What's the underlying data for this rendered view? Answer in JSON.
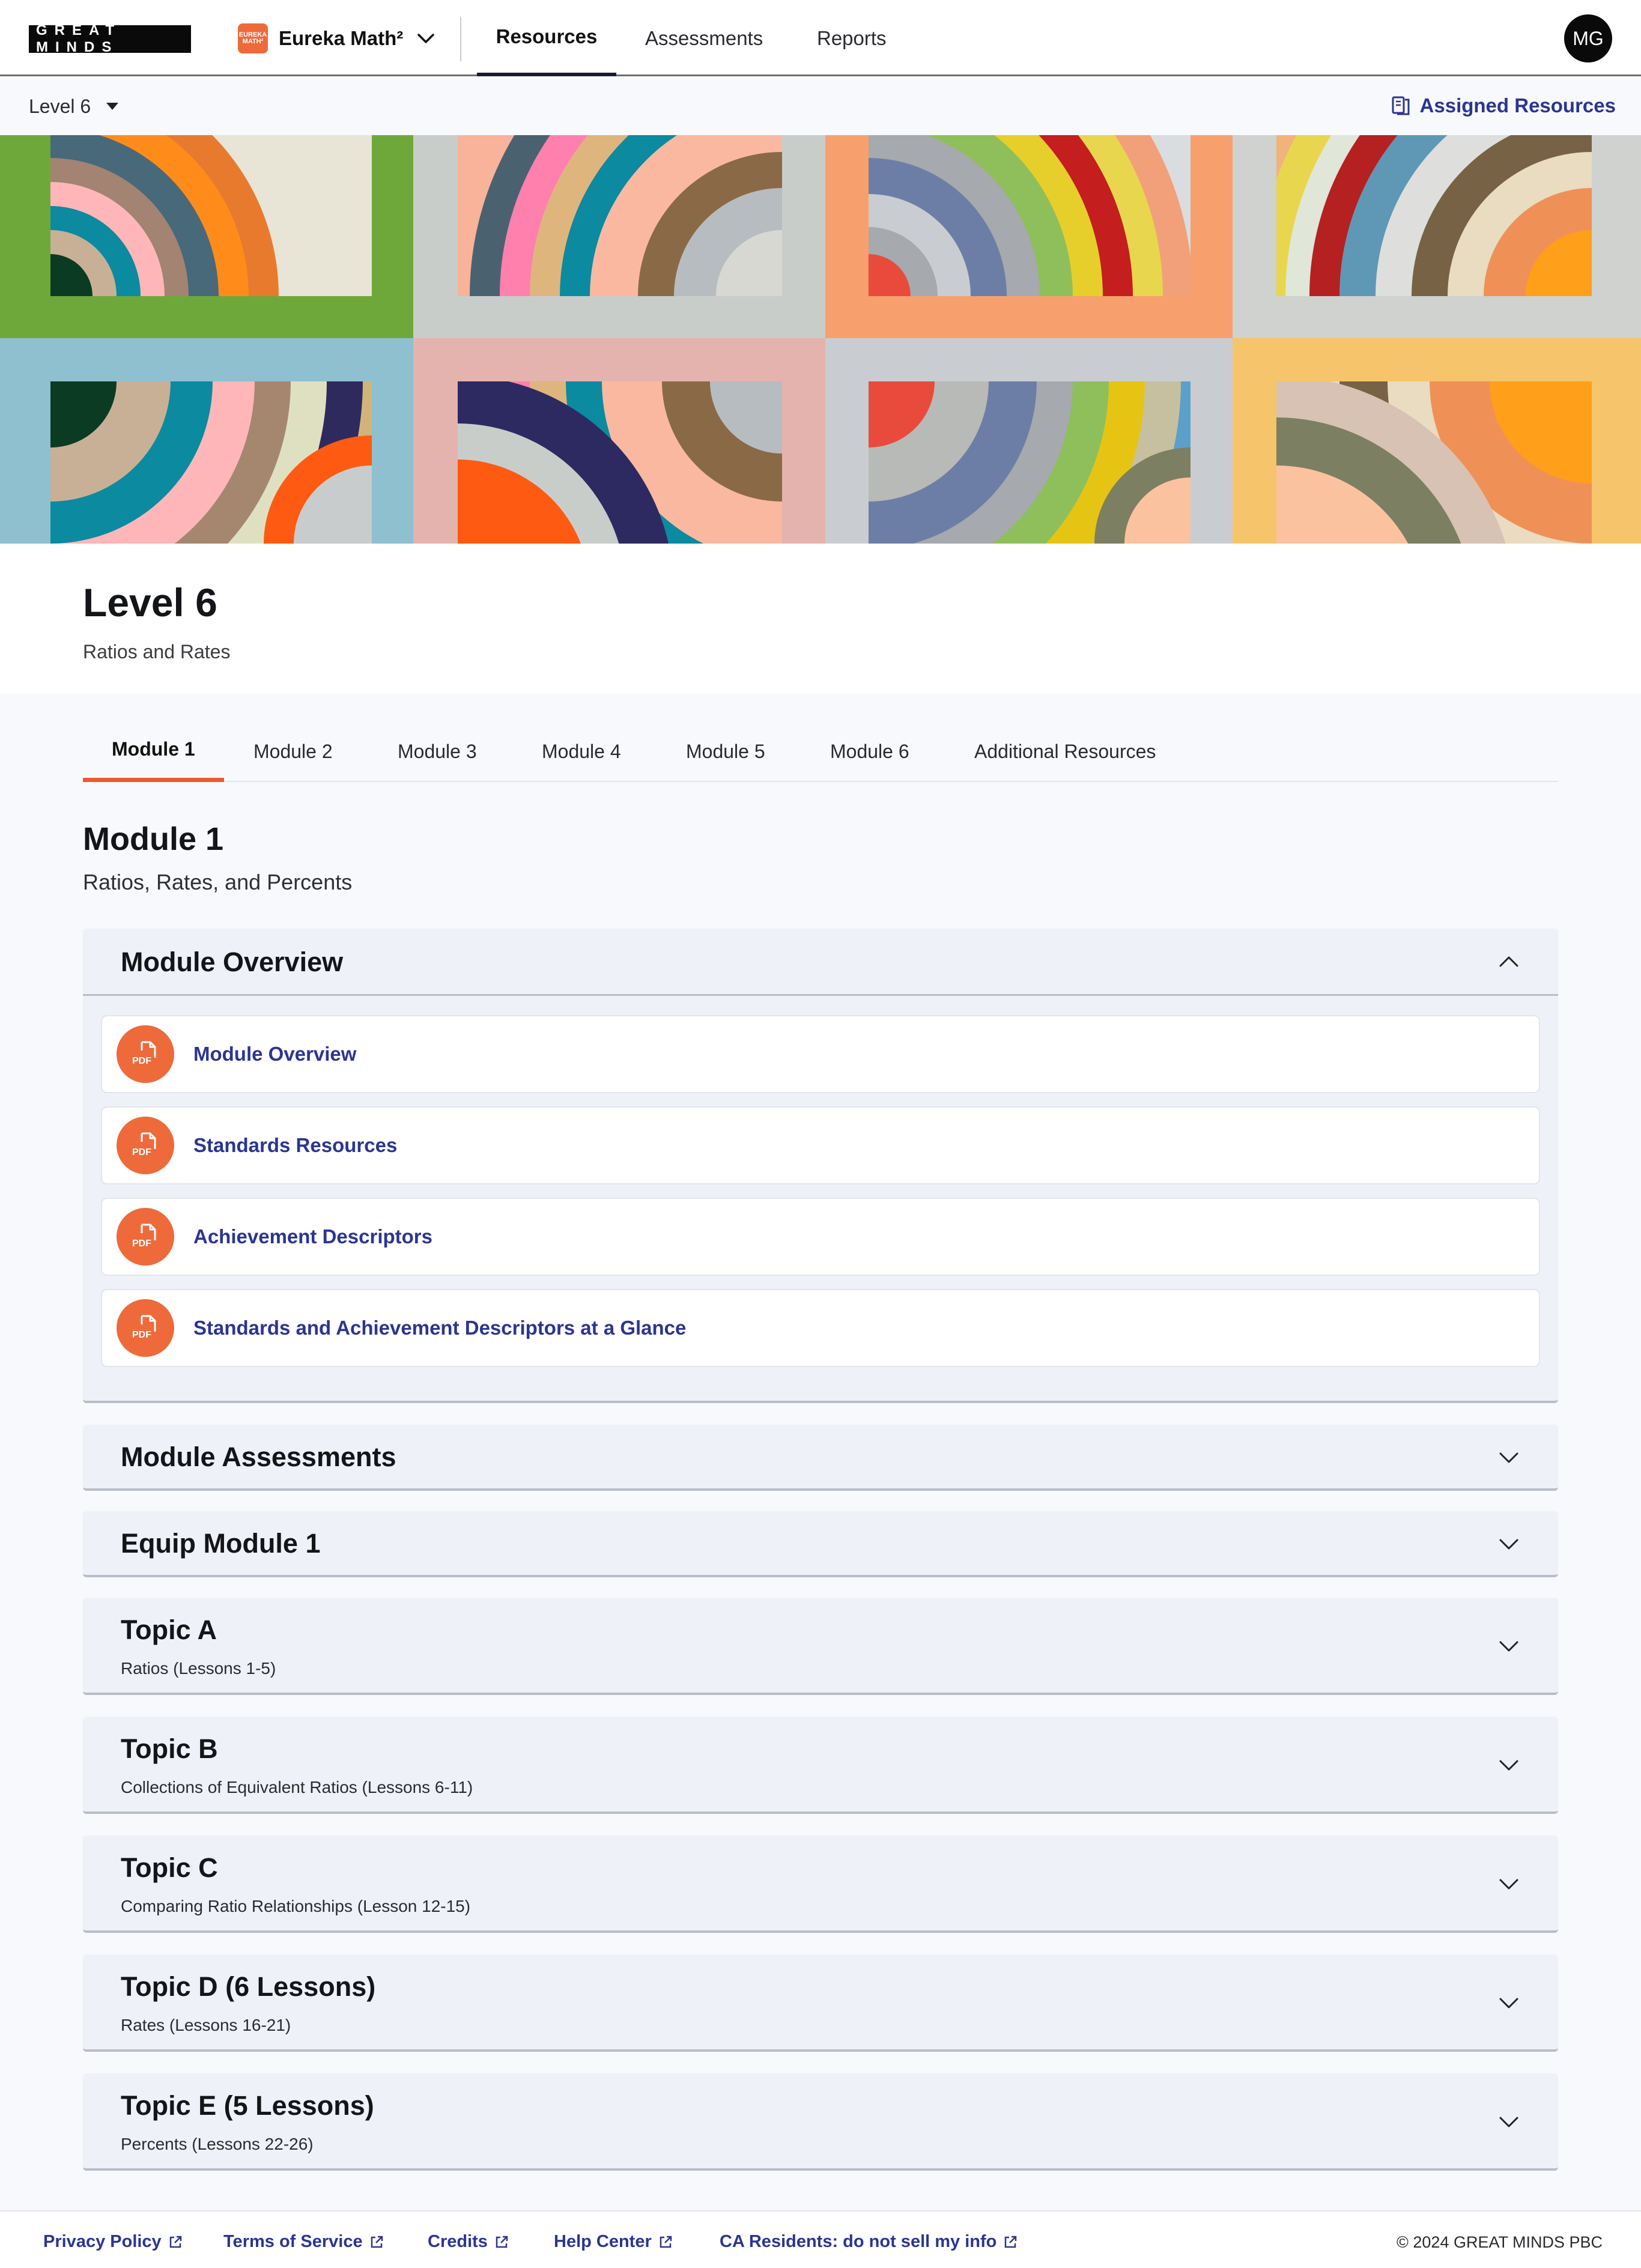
{
  "header": {
    "logo_text": "GREAT MINDS",
    "product_name": "Eureka Math²",
    "product_badge": "EUREKA MATH²",
    "nav": [
      {
        "label": "Resources",
        "active": true
      },
      {
        "label": "Assessments",
        "active": false
      },
      {
        "label": "Reports",
        "active": false
      }
    ],
    "avatar_initials": "MG"
  },
  "subbar": {
    "level_select": "Level 6",
    "assigned_resources": "Assigned Resources"
  },
  "page": {
    "level_title": "Level 6",
    "level_subtitle": "Ratios and Rates"
  },
  "module_tabs": [
    {
      "label": "Module 1",
      "active": true
    },
    {
      "label": "Module 2",
      "active": false
    },
    {
      "label": "Module 3",
      "active": false
    },
    {
      "label": "Module 4",
      "active": false
    },
    {
      "label": "Module 5",
      "active": false
    },
    {
      "label": "Module 6",
      "active": false
    },
    {
      "label": "Additional Resources",
      "active": false
    }
  ],
  "module": {
    "title": "Module 1",
    "subtitle": "Ratios, Rates, and Percents"
  },
  "overview": {
    "title": "Module Overview",
    "expanded": true,
    "items": [
      {
        "label": "Module Overview",
        "icon": "pdf-icon"
      },
      {
        "label": "Standards Resources",
        "icon": "pdf-icon"
      },
      {
        "label": "Achievement Descriptors",
        "icon": "pdf-icon"
      },
      {
        "label": "Standards and Achievement Descriptors at a Glance",
        "icon": "pdf-icon"
      }
    ]
  },
  "sections": [
    {
      "title": "Module Assessments",
      "subtitle": ""
    },
    {
      "title": "Equip Module 1",
      "subtitle": ""
    },
    {
      "title": "Topic A",
      "subtitle": "Ratios (Lessons 1-5)"
    },
    {
      "title": "Topic B",
      "subtitle": "Collections of Equivalent Ratios (Lessons 6-11)"
    },
    {
      "title": "Topic C",
      "subtitle": "Comparing Ratio Relationships (Lesson 12-15)"
    },
    {
      "title": "Topic D (6 Lessons)",
      "subtitle": "Rates (Lessons 16-21)"
    },
    {
      "title": "Topic E (5 Lessons)",
      "subtitle": "Percents (Lessons 22-26)"
    }
  ],
  "footer": {
    "links": [
      "Privacy Policy",
      "Terms of Service",
      "Credits",
      "Help Center",
      "CA Residents: do not sell my info"
    ],
    "copyright": "© 2024 GREAT MINDS PBC"
  },
  "colors": {
    "accent": "#ec5a2c",
    "link": "#2b3592",
    "panel": "#eef1f8"
  }
}
